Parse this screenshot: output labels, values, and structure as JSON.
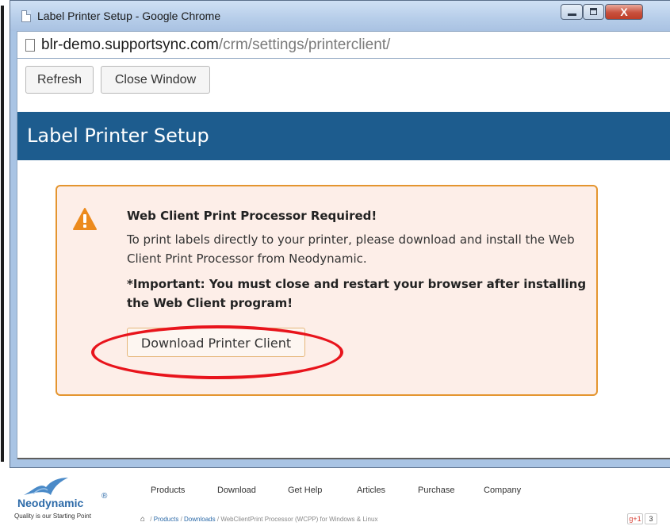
{
  "window": {
    "title": "Label Printer Setup - Google Chrome",
    "controls": {
      "close_glyph": "X"
    }
  },
  "address_bar": {
    "host": "blr-demo.supportsync.com",
    "path": "/crm/settings/printerclient/"
  },
  "toolbar": {
    "refresh_label": "Refresh",
    "close_window_label": "Close Window"
  },
  "page": {
    "title": "Label Printer Setup",
    "banner_color": "#1d5c8e"
  },
  "alert": {
    "icon": "warning-icon",
    "title": "Web Client Print Processor Required!",
    "body": "To print labels directly to your printer, please download and install the Web Client Print Processor from Neodynamic.",
    "important": "*Important: You must close and restart your browser after installing the Web Client program!",
    "download_label": "Download Printer Client",
    "accent_color": "#e4952f"
  },
  "footer": {
    "logo": {
      "name": "Neodynamic",
      "registered": "®",
      "tagline": "Quality is our Starting Point"
    },
    "nav": [
      "Products",
      "Download",
      "Get Help",
      "Articles",
      "Purchase",
      "Company"
    ],
    "breadcrumb": {
      "sep": "/",
      "items": [
        "Products",
        "Downloads",
        "WebClientPrint Processor (WCPP) for Windows & Linux"
      ]
    },
    "gplus_label": "g+1",
    "gplus_count": "3"
  }
}
